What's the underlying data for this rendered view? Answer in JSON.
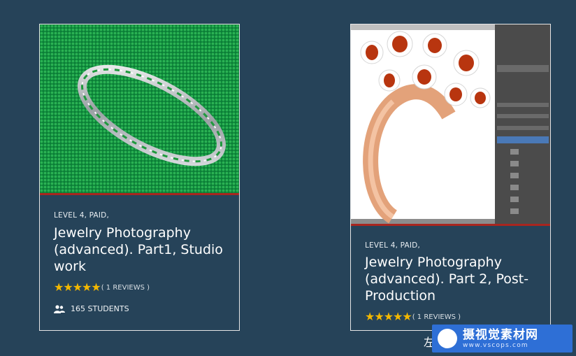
{
  "courses": [
    {
      "meta": "LEVEL 4, PAID,",
      "title": "Jewelry Photography (advanced). Part1, Studio work",
      "stars": "★★★★★",
      "reviews": "( 1 REVIEWS )",
      "students": "165 STUDENTS"
    },
    {
      "meta": "LEVEL 4, PAID,",
      "title": "Jewelry Photography (advanced). Part 2, Post-Production",
      "stars": "★★★★★",
      "reviews": "( 1 REVIEWS )"
    }
  ],
  "watermark": {
    "title": "摄视觉素材网",
    "url": "www.vscops.com",
    "fragment": "左"
  },
  "colors": {
    "background": "#264359",
    "accent_red": "#a8261f",
    "star": "#f4b800",
    "watermark": "#2e6fd6"
  }
}
